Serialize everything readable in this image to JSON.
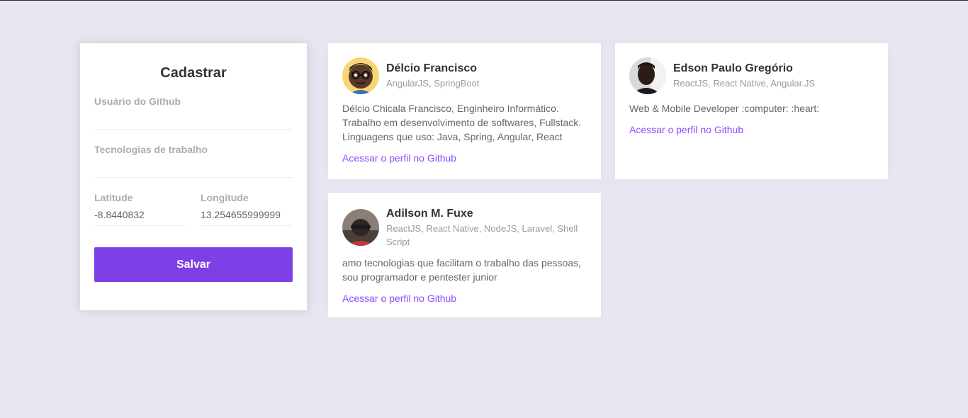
{
  "form": {
    "title": "Cadastrar",
    "github_user_label": "Usuário do Github",
    "github_user_value": "",
    "techs_label": "Tecnologias de trabalho",
    "techs_value": "",
    "latitude_label": "Latitude",
    "latitude_value": "-8.8440832",
    "longitude_label": "Longitude",
    "longitude_value": "13.254655999999",
    "save_label": "Salvar",
    "accent_color": "#7d40e7"
  },
  "devs": [
    {
      "name": "Délcio Francisco",
      "techs": "AngularJS, SpringBoot",
      "bio": "Délcio Chicala Francisco, Enginheiro Informático. Trabalho em desenvolvimento de softwares, Fullstack. Linguagens que uso: Java, Spring, Angular, React",
      "link": "Acessar o perfil no Github"
    },
    {
      "name": "Edson Paulo Gregório",
      "techs": "ReactJS, React Native, Angular.JS",
      "bio": "Web & Mobile Developer :computer: :heart:",
      "link": "Acessar o perfil no Github"
    },
    {
      "name": "Adilson M. Fuxe",
      "techs": "ReactJS, React Native, NodeJS, Laravel, Shell Script",
      "bio": "amo tecnologias que facilitam o trabalho das pessoas, sou programador e pentester junior",
      "link": "Acessar o perfil no Github"
    }
  ],
  "link_color": "#8e4dff"
}
